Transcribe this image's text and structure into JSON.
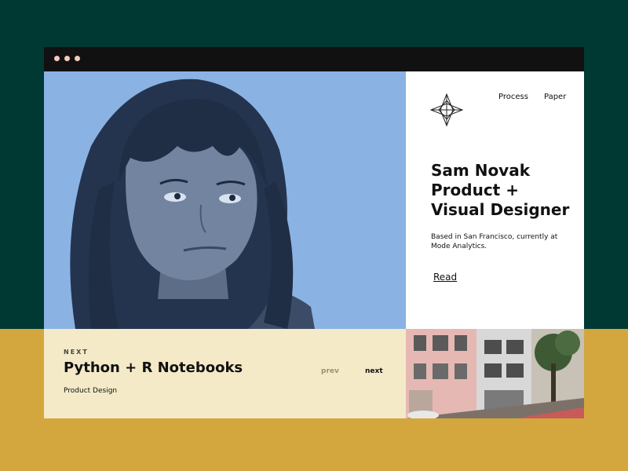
{
  "window": {
    "controls": [
      "dot-1",
      "dot-2",
      "dot-3"
    ]
  },
  "hero": {
    "image": "portrait-photo",
    "background_color": "#8ab3e4"
  },
  "header": {
    "logo_icon": "star-compass-logo",
    "nav": [
      "Process",
      "Paper"
    ]
  },
  "intro": {
    "name_lines": [
      "Sam Novak",
      "Product +",
      "Visual Designer"
    ],
    "description": "Based in San Francisco, currently at Mode Analytics.",
    "read_label": "Read"
  },
  "next_project": {
    "label": "NEXT",
    "title": "Python + R Notebooks",
    "category": "Product Design",
    "prev_label": "prev",
    "next_label": "next",
    "image": "san-francisco-street-photo"
  },
  "colors": {
    "outer_top": "#003833",
    "outer_bottom": "#d3a73e",
    "hero_blue": "#8ab3e4",
    "next_panel": "#f4eac8",
    "titlebar": "#111111",
    "window_dots": "#f3cabb"
  }
}
